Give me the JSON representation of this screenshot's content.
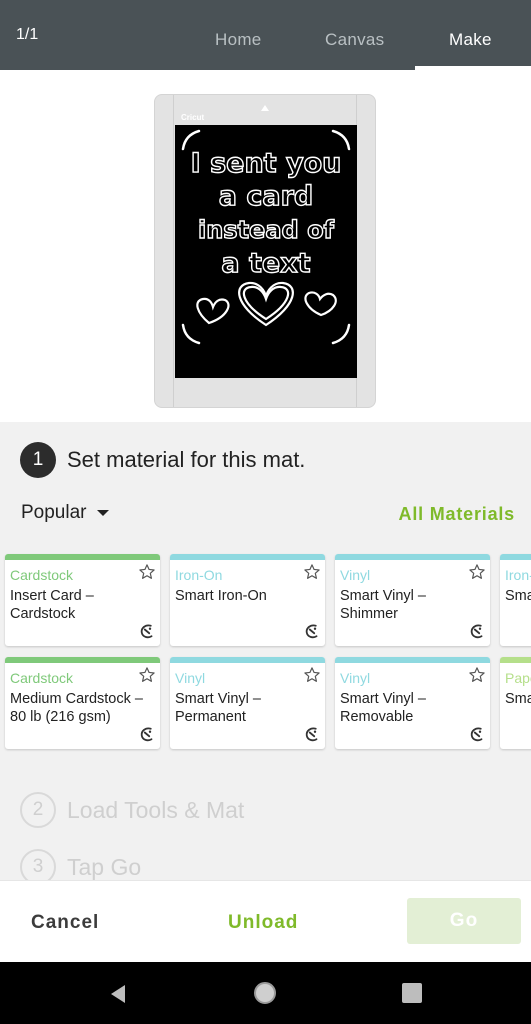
{
  "header": {
    "page_counter": "1/1",
    "tabs": [
      {
        "label": "Home",
        "active": false
      },
      {
        "label": "Canvas",
        "active": false
      },
      {
        "label": "Make",
        "active": true
      }
    ]
  },
  "preview": {
    "mat_brand": "Cricut",
    "card_lines": [
      "I sent you",
      "a card",
      "instead of",
      "a text"
    ]
  },
  "steps": [
    {
      "number": "1",
      "label": "Set material for this mat."
    },
    {
      "number": "2",
      "label": "Load Tools & Mat"
    },
    {
      "number": "3",
      "label": "Tap Go"
    }
  ],
  "materials": {
    "filter_label": "Popular",
    "all_materials_label": "All Materials",
    "colors": {
      "Cardstock": "#7fc97a",
      "Iron-On": "#8fd9e0",
      "Vinyl": "#8fd9e0",
      "Paper": "#b5df8a"
    },
    "tiles": [
      {
        "category": "Cardstock",
        "name": "Insert Card – Cardstock"
      },
      {
        "category": "Iron-On",
        "name": "Smart Iron-On"
      },
      {
        "category": "Vinyl",
        "name": "Smart Vinyl – Shimmer"
      },
      {
        "category": "Iron-On",
        "name": "Smart Iron-On Glitter"
      },
      {
        "category": "Cardstock",
        "name": "Medium Cardstock – 80 lb (216 gsm)"
      },
      {
        "category": "Vinyl",
        "name": "Smart Vinyl – Permanent"
      },
      {
        "category": "Vinyl",
        "name": "Smart Vinyl – Removable"
      },
      {
        "category": "Paper",
        "name": "Smart Paper Writable"
      }
    ]
  },
  "actions": {
    "cancel": "Cancel",
    "unload": "Unload",
    "go": "Go"
  },
  "system_nav": {
    "icons": [
      "back-icon",
      "home-icon",
      "recents-icon"
    ]
  }
}
